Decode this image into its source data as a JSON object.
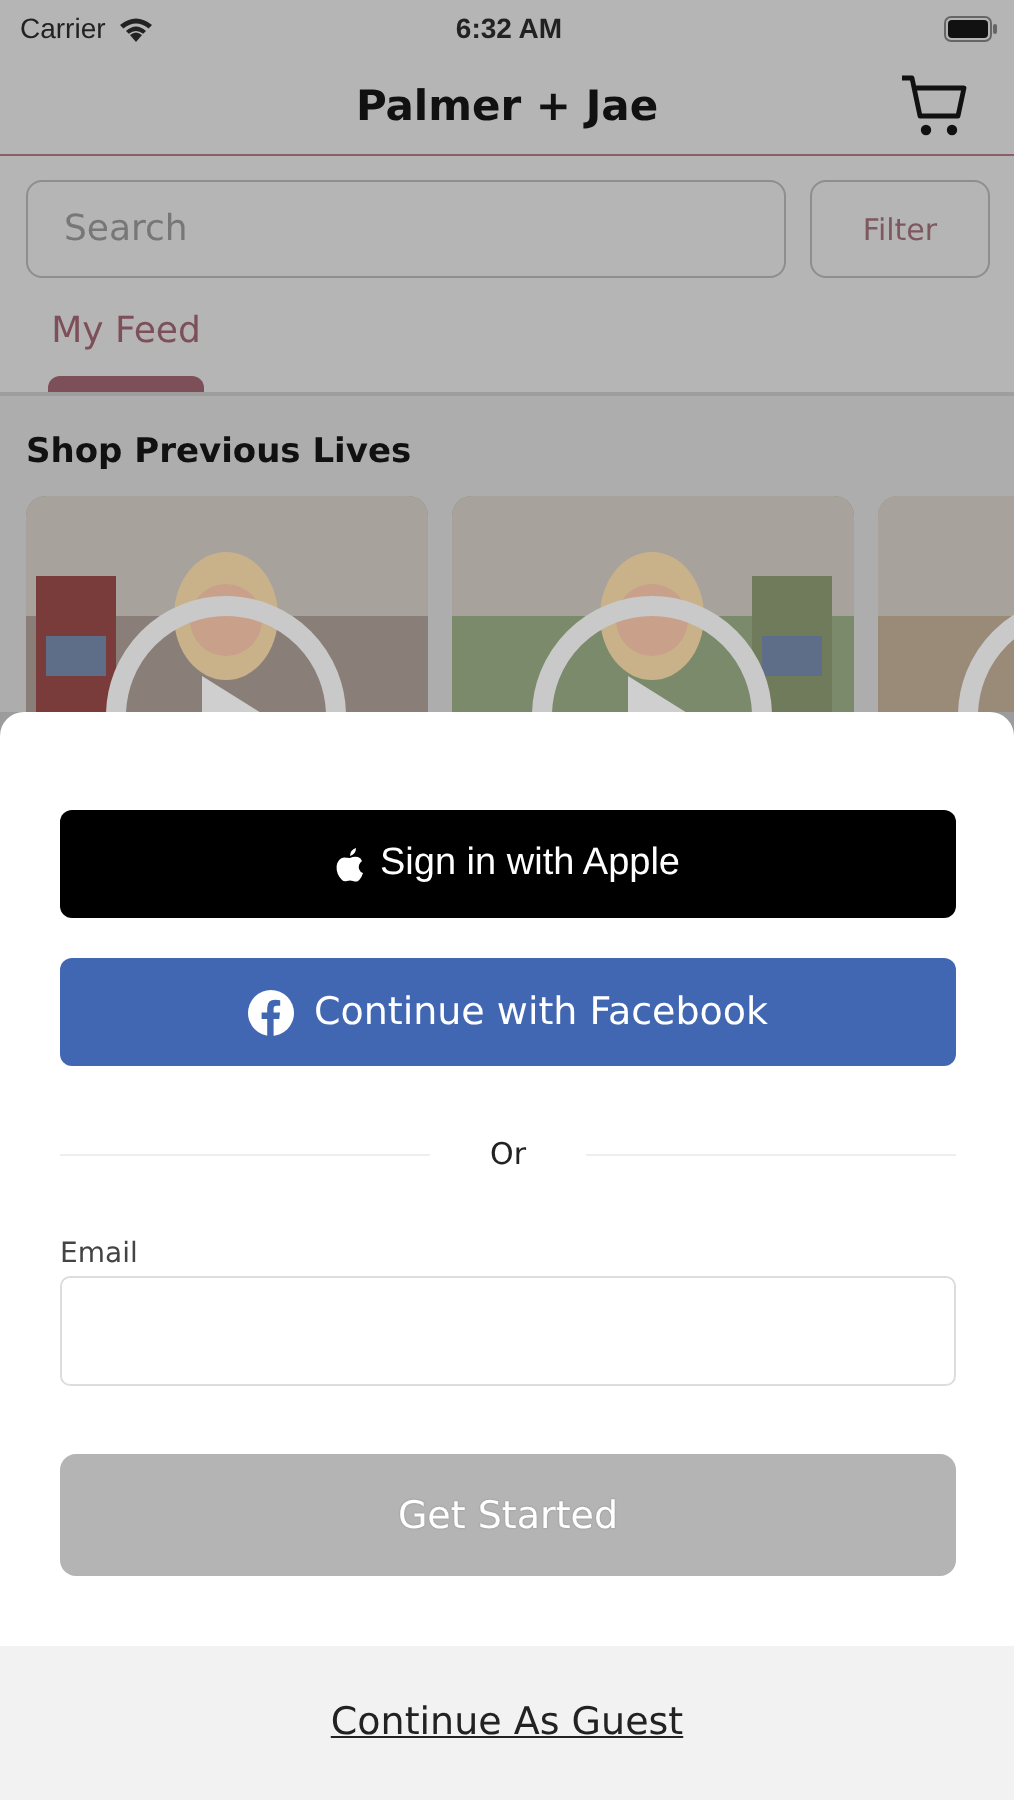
{
  "status_bar": {
    "carrier": "Carrier",
    "time": "6:32 AM"
  },
  "nav": {
    "title": "Palmer + Jae"
  },
  "search": {
    "placeholder": "Search"
  },
  "filter_button": "Filter",
  "tabs": [
    {
      "label": "My Feed",
      "selected": true
    }
  ],
  "section": {
    "title": "Shop Previous Lives"
  },
  "sheet": {
    "apple_button": "Sign in with Apple",
    "facebook_button": "Continue with Facebook",
    "divider": "Or",
    "email": {
      "label": "Email"
    },
    "submit": {
      "label": "Get Started",
      "disabled": true
    },
    "guest_link": "Continue As Guest"
  }
}
